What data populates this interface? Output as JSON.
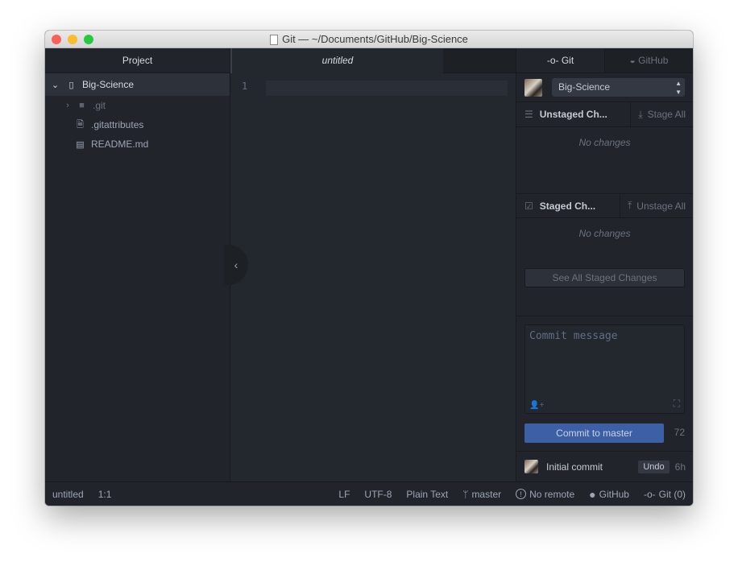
{
  "window": {
    "title": "Git — ~/Documents/GitHub/Big-Science"
  },
  "tree": {
    "header": "Project",
    "root": "Big-Science",
    "items": [
      {
        "name": ".git",
        "type": "folder"
      },
      {
        "name": ".gitattributes",
        "type": "file"
      },
      {
        "name": "README.md",
        "type": "book"
      }
    ]
  },
  "editor": {
    "tab": "untitled",
    "line_number": "1"
  },
  "git": {
    "tabs": [
      "Git",
      "GitHub"
    ],
    "repo": "Big-Science",
    "unstaged": {
      "title": "Unstaged Ch...",
      "action": "Stage All",
      "empty": "No changes"
    },
    "staged": {
      "title": "Staged Ch...",
      "action": "Unstage All",
      "empty": "No changes"
    },
    "see_all": "See All Staged Changes",
    "commit_placeholder": "Commit message",
    "commit_button": "Commit to master",
    "char_count": "72",
    "recent": {
      "message": "Initial commit",
      "undo": "Undo",
      "age": "6h"
    }
  },
  "status": {
    "file": "untitled",
    "cursor": "1:1",
    "line_ending": "LF",
    "encoding": "UTF-8",
    "grammar": "Plain Text",
    "branch": "master",
    "remote": "No remote",
    "github": "GitHub",
    "git": "Git (0)"
  },
  "colors": {
    "accent": "#3d5fa5",
    "background": "#21252b"
  }
}
